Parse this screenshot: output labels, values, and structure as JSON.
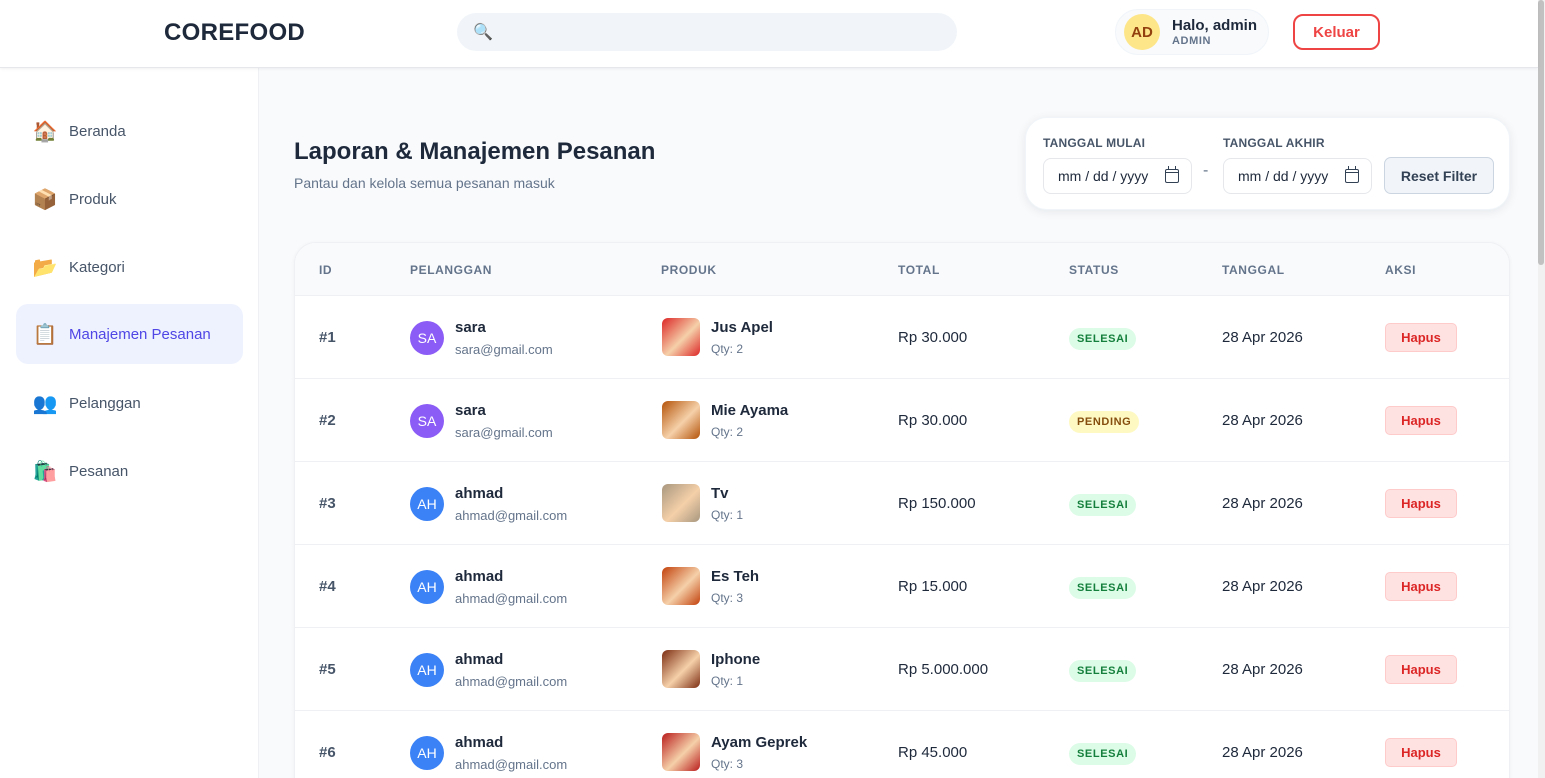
{
  "header": {
    "logo": "COREFOOD",
    "search_placeholder": "",
    "user_avatar": "AD",
    "user_name": "Halo, admin",
    "user_role": "ADMIN",
    "logout_label": "Keluar"
  },
  "sidebar": {
    "items": [
      {
        "label": "Beranda",
        "icon": "🏠"
      },
      {
        "label": "Produk",
        "icon": "📦"
      },
      {
        "label": "Kategori",
        "icon": "📂"
      },
      {
        "label": "Manajemen Pesanan",
        "icon": "📋"
      },
      {
        "label": "Pelanggan",
        "icon": "👥"
      },
      {
        "label": "Pesanan",
        "icon": "🛍️"
      }
    ],
    "active_index": 3
  },
  "page": {
    "title": "Laporan & Manajemen Pesanan",
    "subtitle": "Pantau dan kelola semua pesanan masuk"
  },
  "filter": {
    "start_label": "TANGGAL MULAI",
    "end_label": "TANGGAL AKHIR",
    "start_value": "mm / dd / yyyy",
    "end_value": "mm / dd / yyyy",
    "separator": "-",
    "reset_label": "Reset Filter"
  },
  "table": {
    "headers": [
      "ID",
      "PELANGGAN",
      "PRODUK",
      "TOTAL",
      "STATUS",
      "TANGGAL",
      "AKSI"
    ],
    "rows": [
      {
        "id": "#1",
        "avatar": "SA",
        "avatar_color": "#8b5cf6",
        "name": "sara",
        "email": "sara@gmail.com",
        "product": "Jus Apel",
        "qty": "Qty: 2",
        "thumb_color": "#dc2626",
        "total": "Rp 30.000",
        "status": "SELESAI",
        "status_type": "selesai",
        "date": "28 Apr 2026",
        "action": "Hapus"
      },
      {
        "id": "#2",
        "avatar": "SA",
        "avatar_color": "#8b5cf6",
        "name": "sara",
        "email": "sara@gmail.com",
        "product": "Mie Ayama",
        "qty": "Qty: 2",
        "thumb_color": "#b45309",
        "total": "Rp 30.000",
        "status": "PENDING",
        "status_type": "pending",
        "date": "28 Apr 2026",
        "action": "Hapus"
      },
      {
        "id": "#3",
        "avatar": "AH",
        "avatar_color": "#3b82f6",
        "name": "ahmad",
        "email": "ahmad@gmail.com",
        "product": "Tv",
        "qty": "Qty: 1",
        "thumb_color": "#a8977f",
        "total": "Rp 150.000",
        "status": "SELESAI",
        "status_type": "selesai",
        "date": "28 Apr 2026",
        "action": "Hapus"
      },
      {
        "id": "#4",
        "avatar": "AH",
        "avatar_color": "#3b82f6",
        "name": "ahmad",
        "email": "ahmad@gmail.com",
        "product": "Es Teh",
        "qty": "Qty: 3",
        "thumb_color": "#c2410c",
        "total": "Rp 15.000",
        "status": "SELESAI",
        "status_type": "selesai",
        "date": "28 Apr 2026",
        "action": "Hapus"
      },
      {
        "id": "#5",
        "avatar": "AH",
        "avatar_color": "#3b82f6",
        "name": "ahmad",
        "email": "ahmad@gmail.com",
        "product": "Iphone",
        "qty": "Qty: 1",
        "thumb_color": "#7c2d12",
        "total": "Rp 5.000.000",
        "status": "SELESAI",
        "status_type": "selesai",
        "date": "28 Apr 2026",
        "action": "Hapus"
      },
      {
        "id": "#6",
        "avatar": "AH",
        "avatar_color": "#3b82f6",
        "name": "ahmad",
        "email": "ahmad@gmail.com",
        "product": "Ayam Geprek",
        "qty": "Qty: 3",
        "thumb_color": "#b91c1c",
        "total": "Rp 45.000",
        "status": "SELESAI",
        "status_type": "selesai",
        "date": "28 Apr 2026",
        "action": "Hapus"
      }
    ]
  }
}
